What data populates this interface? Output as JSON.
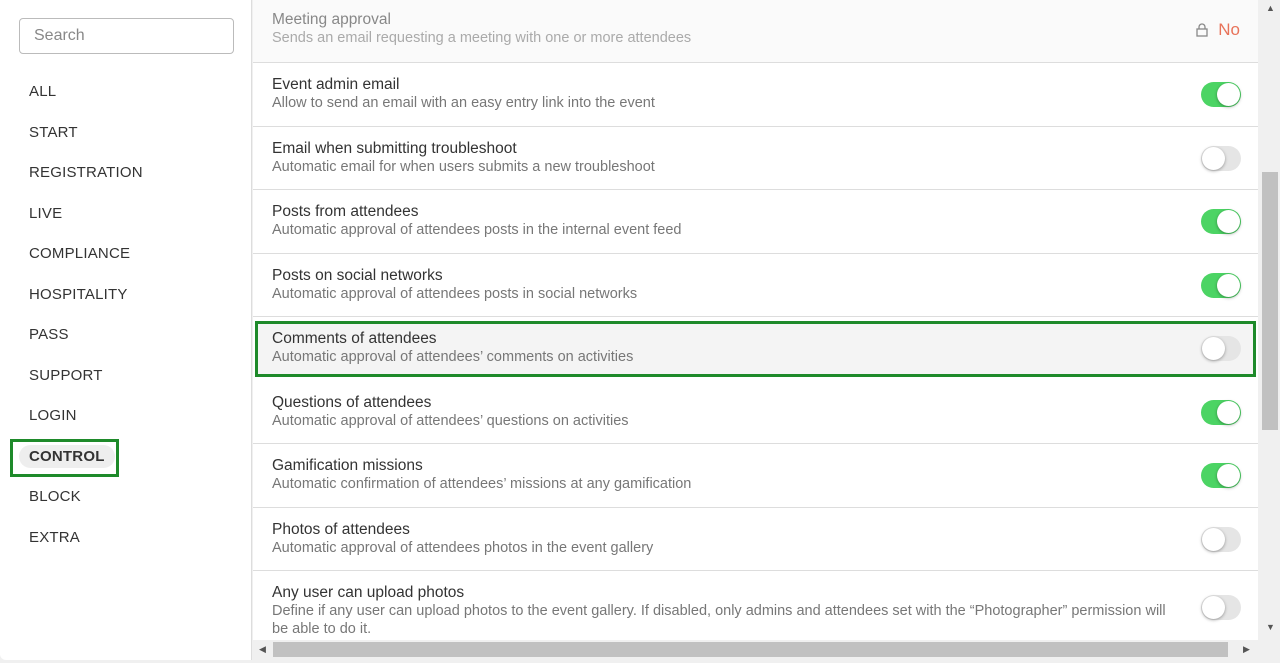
{
  "sidebar": {
    "search_placeholder": "Search",
    "items": [
      "ALL",
      "START",
      "REGISTRATION",
      "LIVE",
      "COMPLIANCE",
      "HOSPITALITY",
      "PASS",
      "SUPPORT",
      "LOGIN",
      "CONTROL",
      "BLOCK",
      "EXTRA"
    ],
    "active": "CONTROL"
  },
  "settings": [
    {
      "title": "Meeting approval",
      "desc": "Sends an email requesting a meeting with one or more attendees",
      "locked": true,
      "value": "No"
    },
    {
      "title": "Event admin email",
      "desc": "Allow to send an email with an easy entry link into the event",
      "on": true
    },
    {
      "title": "Email when submitting troubleshoot",
      "desc": "Automatic email for when users submits a new troubleshoot",
      "on": false
    },
    {
      "title": "Posts from attendees",
      "desc": "Automatic approval of attendees posts in the internal event feed",
      "on": true
    },
    {
      "title": "Posts on social networks",
      "desc": "Automatic approval of attendees posts in social networks",
      "on": true
    },
    {
      "title": "Comments of attendees",
      "desc": "Automatic approval of attendees’ comments on activities",
      "on": false,
      "highlighted": true
    },
    {
      "title": "Questions of attendees",
      "desc": "Automatic approval of attendees’ questions on activities",
      "on": true
    },
    {
      "title": "Gamification missions",
      "desc": "Automatic confirmation of attendees’ missions at any gamification",
      "on": true
    },
    {
      "title": "Photos of attendees",
      "desc": "Automatic approval of attendees photos in the event gallery",
      "on": false
    },
    {
      "title": "Any user can upload photos",
      "desc": "Define if any user can upload photos to the event gallery. If disabled, only admins and attendees set with the “Photographer” permission will be able to do it.",
      "on": false
    }
  ],
  "colors": {
    "toggle_on": "#4cd464",
    "locked_value": "#e8735a",
    "highlight": "#1e8a2a"
  }
}
